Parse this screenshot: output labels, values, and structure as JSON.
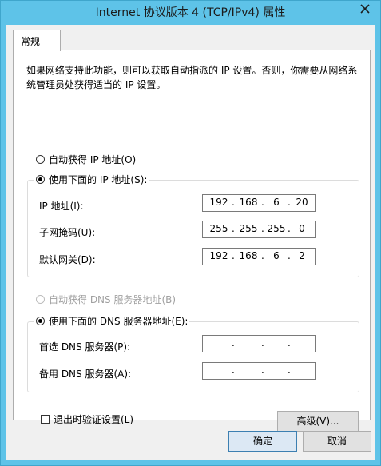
{
  "window": {
    "title": "Internet 协议版本 4 (TCP/IPv4) 属性"
  },
  "tabs": [
    {
      "label": "常规"
    }
  ],
  "general": {
    "description": "如果网络支持此功能，则可以获取自动指派的 IP 设置。否则，你需要从网络系统管理员处获得适当的 IP 设置。",
    "ip_mode": {
      "auto_label": "自动获得 IP 地址(O)",
      "auto_selected": false,
      "manual_label": "使用下面的 IP 地址(S):",
      "manual_selected": true
    },
    "ip_fields": [
      {
        "label": "IP 地址(I):",
        "octets": [
          "192",
          "168",
          "6",
          "20"
        ]
      },
      {
        "label": "子网掩码(U):",
        "octets": [
          "255",
          "255",
          "255",
          "0"
        ]
      },
      {
        "label": "默认网关(D):",
        "octets": [
          "192",
          "168",
          "6",
          "2"
        ]
      }
    ],
    "dns_mode": {
      "auto_label": "自动获得 DNS 服务器地址(B)",
      "auto_selected": false,
      "auto_disabled": true,
      "manual_label": "使用下面的 DNS 服务器地址(E):",
      "manual_selected": true
    },
    "dns_fields": [
      {
        "label": "首选 DNS 服务器(P):",
        "octets": [
          "",
          "",
          "",
          ""
        ]
      },
      {
        "label": "备用 DNS 服务器(A):",
        "octets": [
          "",
          "",
          "",
          ""
        ]
      }
    ],
    "validate_checkbox": {
      "label": "退出时验证设置(L)",
      "checked": false
    },
    "advanced_button": "高级(V)..."
  },
  "footer": {
    "ok_button": "确定",
    "cancel_button": "取消"
  },
  "colors": {
    "title_bar": "#5ec3e8",
    "dialog_bg": "#f0f0f0",
    "panel_bg": "#ffffff"
  }
}
